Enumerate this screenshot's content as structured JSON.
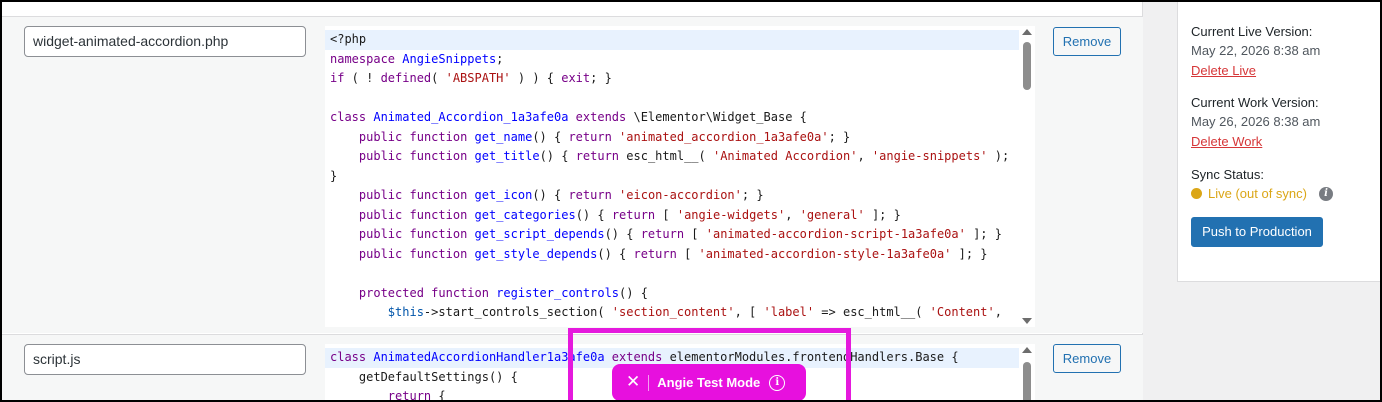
{
  "files": [
    {
      "filename": "widget-animated-accordion.php",
      "remove_label": "Remove",
      "code_lines": [
        [
          [
            "<?php",
            "var"
          ]
        ],
        [
          [
            "namespace ",
            "kw"
          ],
          [
            "AngieSnippets",
            "def"
          ],
          [
            ";",
            "var"
          ]
        ],
        [
          [
            "if",
            "kw"
          ],
          [
            " ( ! ",
            "var"
          ],
          [
            "defined",
            "kw"
          ],
          [
            "( ",
            "var"
          ],
          [
            "'ABSPATH'",
            "str"
          ],
          [
            " ) ) { ",
            "var"
          ],
          [
            "exit",
            "kw"
          ],
          [
            "; }",
            "var"
          ]
        ],
        [],
        [
          [
            "class ",
            "kw"
          ],
          [
            "Animated_Accordion_1a3afe0a",
            "def"
          ],
          [
            " ",
            "var"
          ],
          [
            "extends",
            "kw"
          ],
          [
            " \\Elementor\\Widget_Base {",
            "var"
          ]
        ],
        [
          [
            "    ",
            "var"
          ],
          [
            "public",
            "kw"
          ],
          [
            " ",
            "var"
          ],
          [
            "function",
            "kw"
          ],
          [
            " ",
            "var"
          ],
          [
            "get_name",
            "def"
          ],
          [
            "() { ",
            "var"
          ],
          [
            "return",
            "kw"
          ],
          [
            " ",
            "var"
          ],
          [
            "'animated_accordion_1a3afe0a'",
            "str"
          ],
          [
            "; }",
            "var"
          ]
        ],
        [
          [
            "    ",
            "var"
          ],
          [
            "public",
            "kw"
          ],
          [
            " ",
            "var"
          ],
          [
            "function",
            "kw"
          ],
          [
            " ",
            "var"
          ],
          [
            "get_title",
            "def"
          ],
          [
            "() { ",
            "var"
          ],
          [
            "return",
            "kw"
          ],
          [
            " esc_html__( ",
            "var"
          ],
          [
            "'Animated Accordion'",
            "str"
          ],
          [
            ", ",
            "var"
          ],
          [
            "'angie-snippets'",
            "str"
          ],
          [
            " );",
            "var"
          ]
        ],
        [
          [
            "}",
            "var"
          ]
        ],
        [
          [
            "    ",
            "var"
          ],
          [
            "public",
            "kw"
          ],
          [
            " ",
            "var"
          ],
          [
            "function",
            "kw"
          ],
          [
            " ",
            "var"
          ],
          [
            "get_icon",
            "def"
          ],
          [
            "() { ",
            "var"
          ],
          [
            "return",
            "kw"
          ],
          [
            " ",
            "var"
          ],
          [
            "'eicon-accordion'",
            "str"
          ],
          [
            "; }",
            "var"
          ]
        ],
        [
          [
            "    ",
            "var"
          ],
          [
            "public",
            "kw"
          ],
          [
            " ",
            "var"
          ],
          [
            "function",
            "kw"
          ],
          [
            " ",
            "var"
          ],
          [
            "get_categories",
            "def"
          ],
          [
            "() { ",
            "var"
          ],
          [
            "return",
            "kw"
          ],
          [
            " [ ",
            "var"
          ],
          [
            "'angie-widgets'",
            "str"
          ],
          [
            ", ",
            "var"
          ],
          [
            "'general'",
            "str"
          ],
          [
            " ]; }",
            "var"
          ]
        ],
        [
          [
            "    ",
            "var"
          ],
          [
            "public",
            "kw"
          ],
          [
            " ",
            "var"
          ],
          [
            "function",
            "kw"
          ],
          [
            " ",
            "var"
          ],
          [
            "get_script_depends",
            "def"
          ],
          [
            "() { ",
            "var"
          ],
          [
            "return",
            "kw"
          ],
          [
            " [ ",
            "var"
          ],
          [
            "'animated-accordion-script-1a3afe0a'",
            "str"
          ],
          [
            " ]; }",
            "var"
          ]
        ],
        [
          [
            "    ",
            "var"
          ],
          [
            "public",
            "kw"
          ],
          [
            " ",
            "var"
          ],
          [
            "function",
            "kw"
          ],
          [
            " ",
            "var"
          ],
          [
            "get_style_depends",
            "def"
          ],
          [
            "() { ",
            "var"
          ],
          [
            "return",
            "kw"
          ],
          [
            " [ ",
            "var"
          ],
          [
            "'animated-accordion-style-1a3afe0a'",
            "str"
          ],
          [
            " ]; }",
            "var"
          ]
        ],
        [],
        [
          [
            "    ",
            "var"
          ],
          [
            "protected",
            "kw"
          ],
          [
            " ",
            "var"
          ],
          [
            "function",
            "kw"
          ],
          [
            " ",
            "var"
          ],
          [
            "register_controls",
            "def"
          ],
          [
            "() {",
            "var"
          ]
        ],
        [
          [
            "        ",
            "var"
          ],
          [
            "$this",
            "var2"
          ],
          [
            "->start_controls_section( ",
            "var"
          ],
          [
            "'section_content'",
            "str"
          ],
          [
            ", [ ",
            "var"
          ],
          [
            "'label'",
            "str"
          ],
          [
            " => esc_html__( ",
            "var"
          ],
          [
            "'Content'",
            "str"
          ],
          [
            ",",
            "var"
          ]
        ]
      ]
    },
    {
      "filename": "script.js",
      "remove_label": "Remove",
      "code_lines": [
        [
          [
            "class ",
            "kw"
          ],
          [
            "AnimatedAccordionHandler1a3afe0a",
            "def"
          ],
          [
            " ",
            "var"
          ],
          [
            "extends",
            "kw"
          ],
          [
            " elementorModules.frontendHandlers.Base {",
            "var"
          ]
        ],
        [
          [
            "    getDefaultSettings() {",
            "var"
          ]
        ],
        [
          [
            "        ",
            "var"
          ],
          [
            "return",
            "kw"
          ],
          [
            " {",
            "var"
          ]
        ]
      ]
    }
  ],
  "sidebar": {
    "live_label": "Current Live Version:",
    "live_value": "May 22, 2026 8:38 am",
    "delete_live": "Delete Live",
    "work_label": "Current Work Version:",
    "work_value": "May 26, 2026 8:38 am",
    "delete_work": "Delete Work",
    "sync_label": "Sync Status:",
    "sync_value": "Live (out of sync)",
    "sync_color": "#dba617",
    "info_glyph": "i",
    "push_label": "Push to Production"
  },
  "test_mode": {
    "close_glyph": "✕",
    "label": "Angie Test Mode",
    "info_glyph": "i",
    "color": "#e710de"
  }
}
